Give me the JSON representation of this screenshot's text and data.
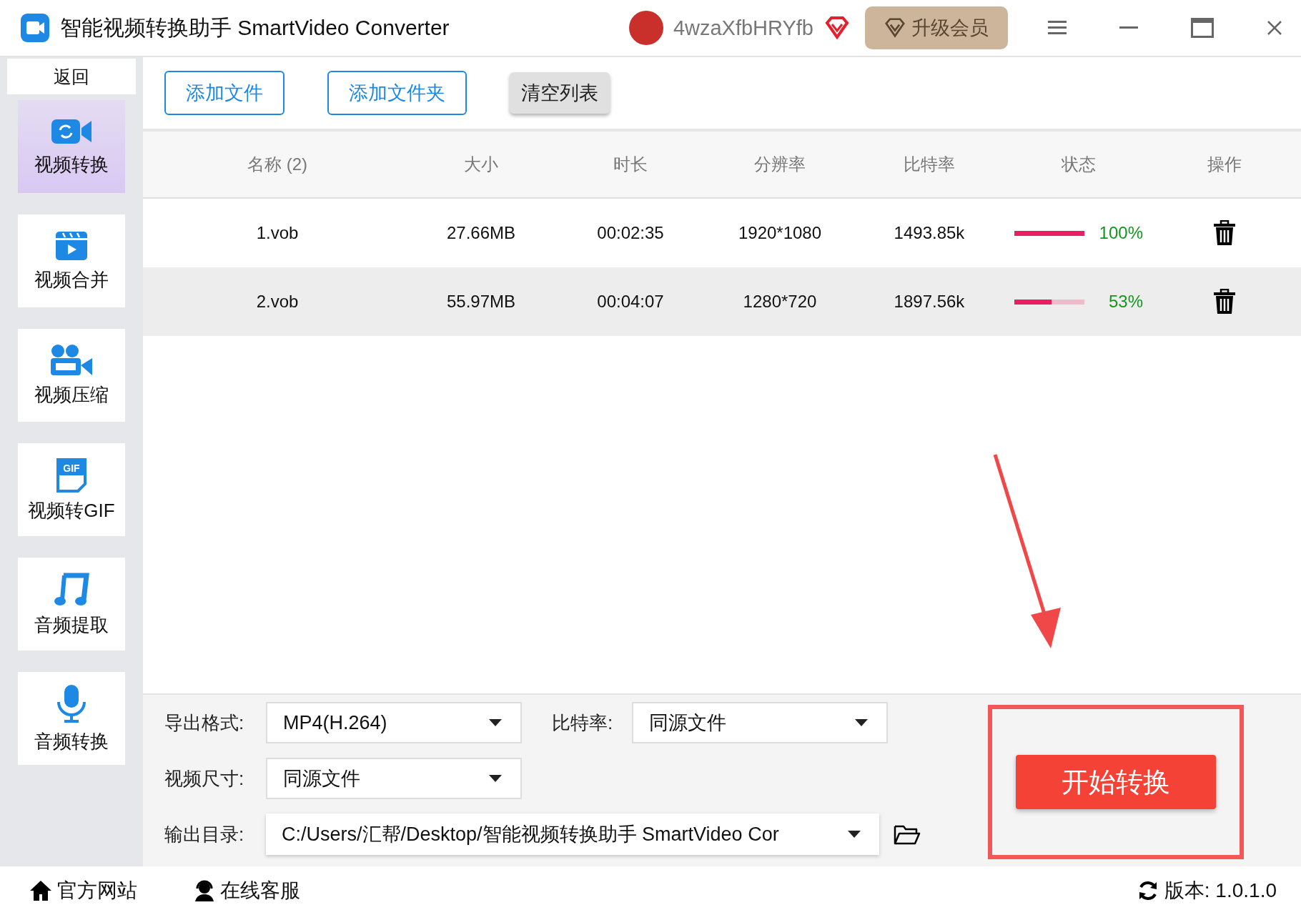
{
  "window": {
    "title": "智能视频转换助手 SmartVideo Converter",
    "user_name": "4wzaXfbHRYfb",
    "upgrade_button": "升级会员"
  },
  "sidebar": {
    "back_button": "返回",
    "items": [
      {
        "label": "视频转换",
        "selected": true
      },
      {
        "label": "视频合并",
        "selected": false
      },
      {
        "label": "视频压缩",
        "selected": false
      },
      {
        "label": "视频转GIF",
        "selected": false,
        "icon_text": "GIF"
      },
      {
        "label": "音频提取",
        "selected": false
      },
      {
        "label": "音频转换",
        "selected": false
      }
    ]
  },
  "toolbar": {
    "buttons": [
      {
        "label": "添加文件",
        "kind": "outline"
      },
      {
        "label": "添加文件夹",
        "kind": "outline"
      },
      {
        "label": "清空列表",
        "kind": "grey"
      }
    ]
  },
  "table": {
    "columns": [
      "名称 (2)",
      "大小",
      "时长",
      "分辨率",
      "比特率",
      "状态",
      "操作"
    ],
    "rows": [
      {
        "name": "1.vob",
        "size": "27.66MB",
        "duration": "00:02:35",
        "resolution": "1920*1080",
        "bitrate": "1493.85k",
        "level": 1.0,
        "status": "100%",
        "selected": false
      },
      {
        "name": "2.vob",
        "size": "55.97MB",
        "duration": "00:04:07",
        "resolution": "1280*720",
        "bitrate": "1897.56k",
        "level": 0.53,
        "status": "53%",
        "selected": true
      }
    ]
  },
  "settings": {
    "format": {
      "label": "导出格式:",
      "value": "MP4(H.264)"
    },
    "bitrate": {
      "label": "比特率:",
      "value": "同源文件"
    },
    "size": {
      "label": "视频尺寸:",
      "value": "同源文件"
    },
    "output": {
      "label": "输出目录:",
      "value": "C:/Users/汇帮/Desktop/智能视频转换助手 SmartVideo Cor"
    }
  },
  "start_button": "开始转换",
  "footer": {
    "links": [
      "官方网站",
      "在线客服"
    ],
    "version": "版本:  1.0.1.0"
  }
}
